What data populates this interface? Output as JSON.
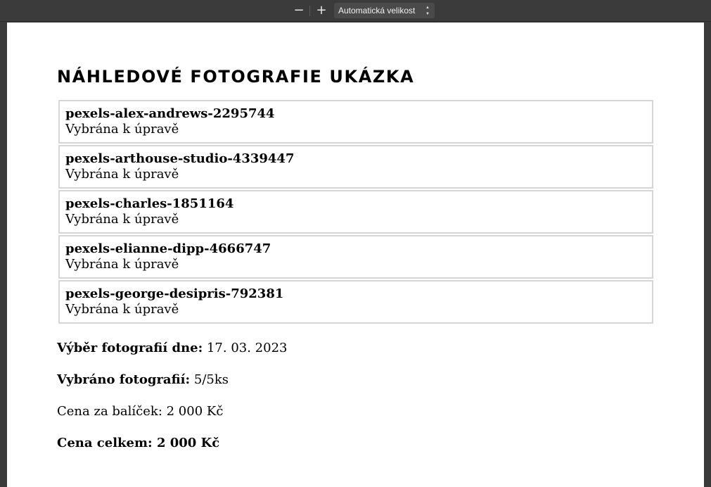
{
  "toolbar": {
    "zoom_out_label": "−",
    "zoom_in_label": "+",
    "zoom_select_value": "Automatická velikost"
  },
  "document": {
    "title": "NÁHLEDOVÉ FOTOGRAFIE UKÁZKA",
    "photos": [
      {
        "name": "pexels-alex-andrews-2295744",
        "status": "Vybrána k úpravě"
      },
      {
        "name": "pexels-arthouse-studio-4339447",
        "status": "Vybrána k úpravě"
      },
      {
        "name": "pexels-charles-1851164",
        "status": "Vybrána k úpravě"
      },
      {
        "name": "pexels-elianne-dipp-4666747",
        "status": "Vybrána k úpravě"
      },
      {
        "name": "pexels-george-desipris-792381",
        "status": "Vybrána k úpravě"
      }
    ],
    "selection_date_label": "Výběr fotografií dne:",
    "selection_date_value": "17. 03. 2023",
    "selected_count_label": "Vybráno fotografií:",
    "selected_count_value": "5/5ks",
    "package_price_label": "Cena za balíček:",
    "package_price_value": "2 000 Kč",
    "total_label": "Cena celkem:",
    "total_value": "2 000 Kč"
  }
}
